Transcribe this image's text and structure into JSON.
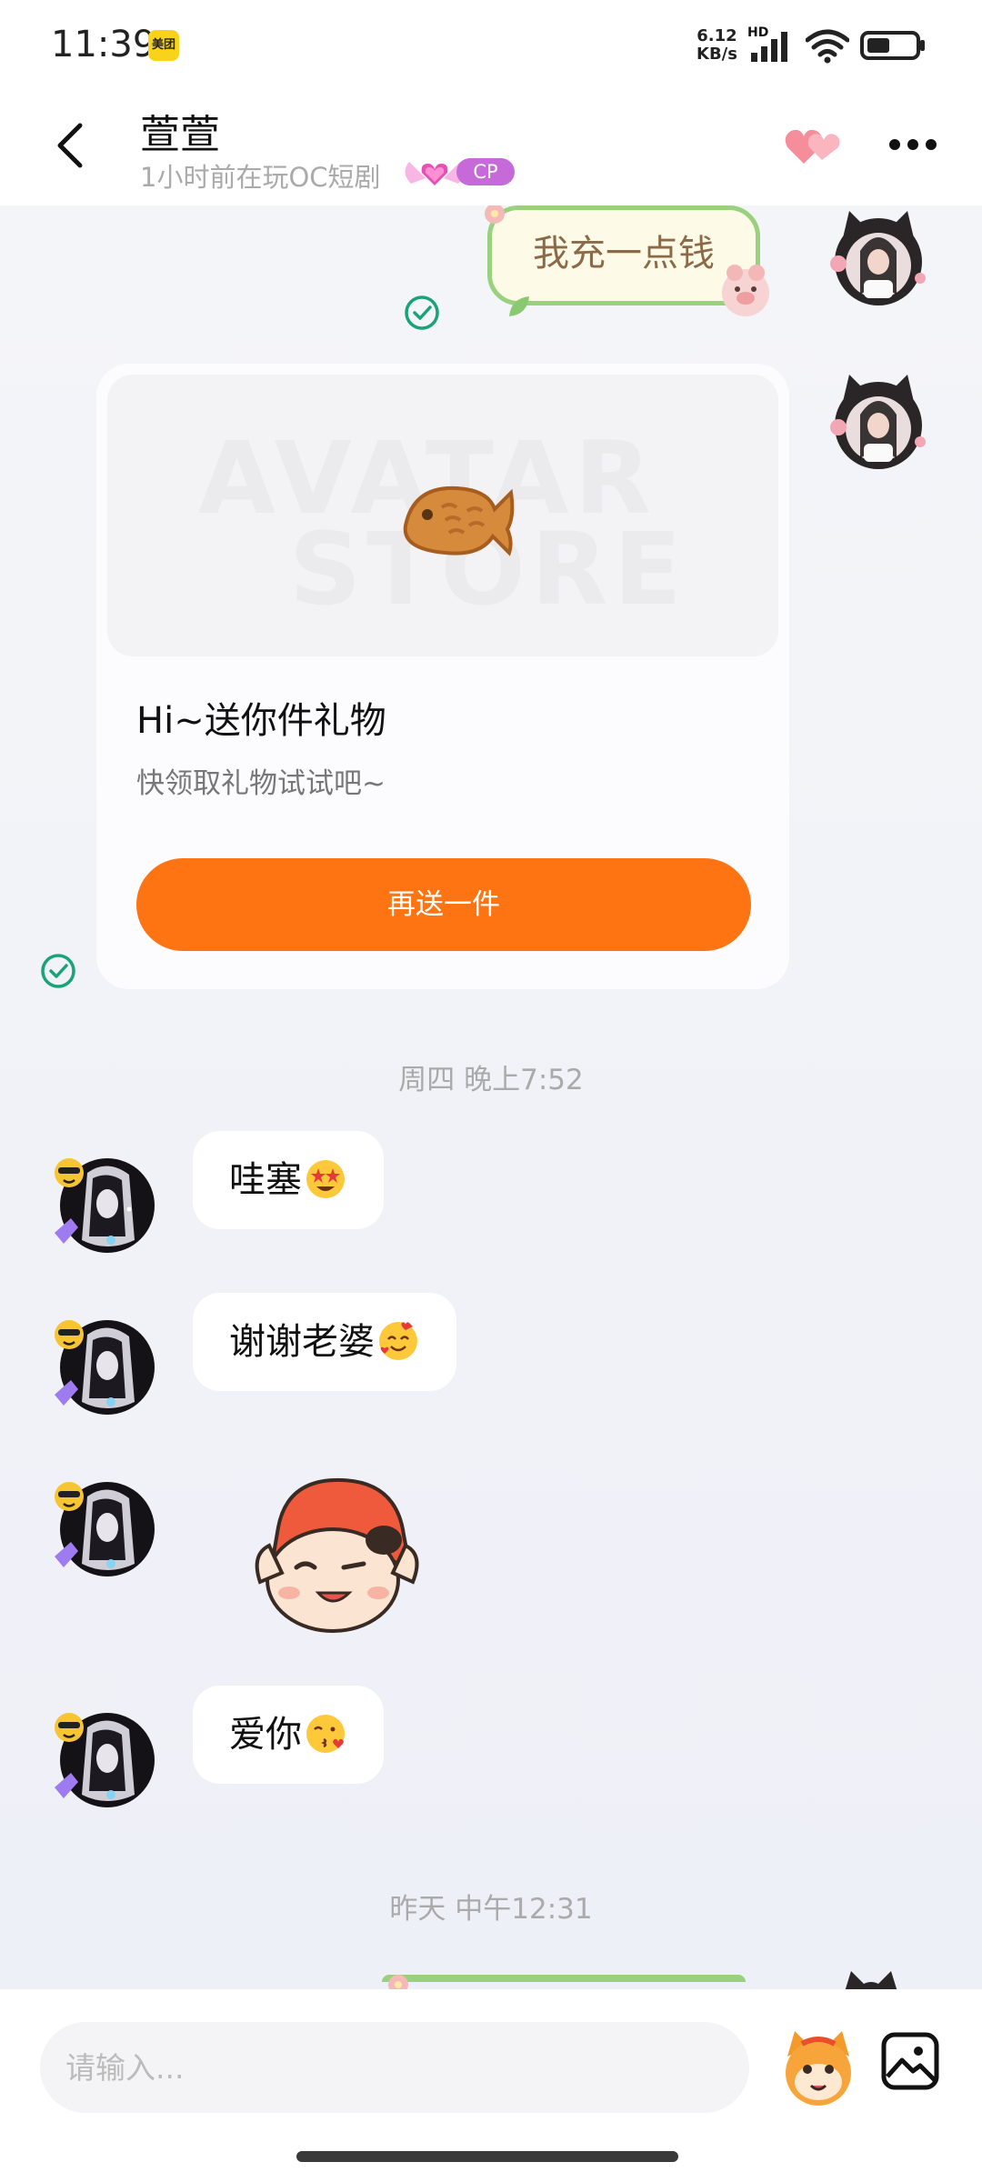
{
  "status_bar": {
    "time": "11:39",
    "app_badge": "美团",
    "net_speed_value": "6.12",
    "net_speed_unit": "KB/s",
    "hd": "HD"
  },
  "header": {
    "name": "萱萱",
    "status": "1小时前在玩OC短剧",
    "badge_label": "CP"
  },
  "messages": {
    "sticker_top_text": "我充一点钱",
    "gift_card": {
      "watermark_line1": "AVATAR",
      "watermark_line2": "STORE",
      "title": "Hi~送你件礼物",
      "subtitle": "快领取礼物试试吧~",
      "button_label": "再送一件"
    },
    "timestamp_1": "周四 晚上7:52",
    "bubble_1": "哇塞",
    "bubble_2": "谢谢老婆",
    "bubble_3": "爱你",
    "timestamp_2": "昨天 中午12:31"
  },
  "input": {
    "placeholder": "请输入..."
  },
  "colors": {
    "accent_orange": "#fe7412",
    "check_green": "#1aa37a",
    "cp_purple": "#c56ad8",
    "sticker_green": "#9ad17f"
  },
  "icons": [
    "back-arrow-icon",
    "heart-icon",
    "more-icon",
    "check-icon",
    "emoji-mascot-icon",
    "image-icon"
  ]
}
